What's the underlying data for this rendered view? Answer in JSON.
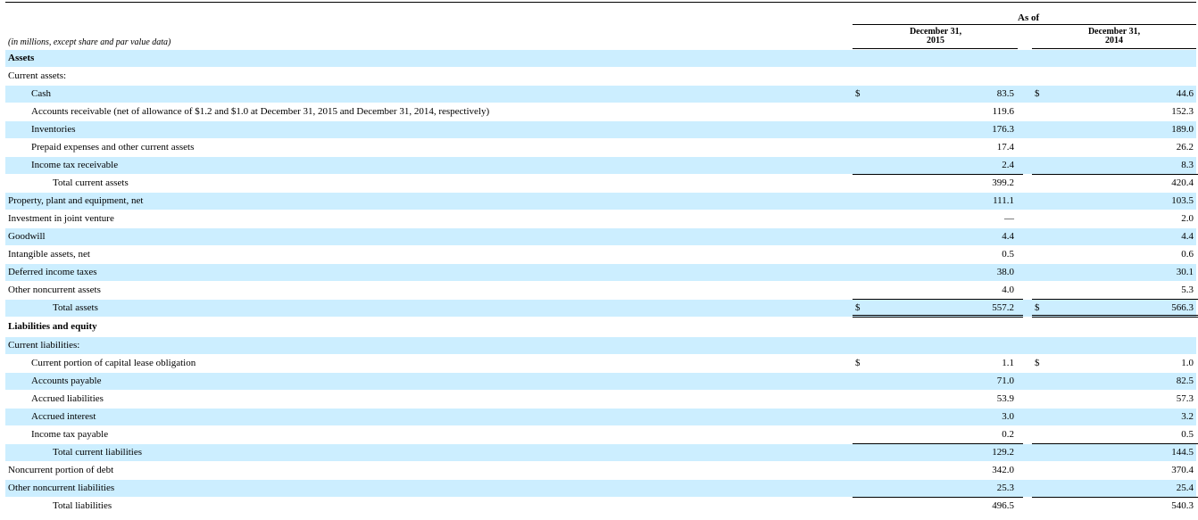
{
  "header": {
    "as_of": "As of",
    "col1_line1": "December 31,",
    "col1_line2": "2015",
    "col2_line1": "December 31,",
    "col2_line2": "2014",
    "units": "(in millions, except share and par value data)"
  },
  "rows": [
    {
      "label": "Assets",
      "c1": "",
      "v1": "",
      "c2": "",
      "v2": ""
    },
    {
      "label": "Current assets:",
      "c1": "",
      "v1": "",
      "c2": "",
      "v2": ""
    },
    {
      "label": "Cash",
      "c1": "$",
      "v1": "83.5",
      "c2": "$",
      "v2": "44.6"
    },
    {
      "label": "Accounts receivable (net of allowance of $1.2 and $1.0 at December 31, 2015 and December 31, 2014, respectively)",
      "c1": "",
      "v1": "119.6",
      "c2": "",
      "v2": "152.3"
    },
    {
      "label": "Inventories",
      "c1": "",
      "v1": "176.3",
      "c2": "",
      "v2": "189.0"
    },
    {
      "label": "Prepaid expenses and other current assets",
      "c1": "",
      "v1": "17.4",
      "c2": "",
      "v2": "26.2"
    },
    {
      "label": "Income tax receivable",
      "c1": "",
      "v1": "2.4",
      "c2": "",
      "v2": "8.3"
    },
    {
      "label": "Total current assets",
      "c1": "",
      "v1": "399.2",
      "c2": "",
      "v2": "420.4"
    },
    {
      "label": "Property, plant and equipment, net",
      "c1": "",
      "v1": "111.1",
      "c2": "",
      "v2": "103.5"
    },
    {
      "label": "Investment in joint venture",
      "c1": "",
      "v1": "—",
      "c2": "",
      "v2": "2.0"
    },
    {
      "label": "Goodwill",
      "c1": "",
      "v1": "4.4",
      "c2": "",
      "v2": "4.4"
    },
    {
      "label": "Intangible assets, net",
      "c1": "",
      "v1": "0.5",
      "c2": "",
      "v2": "0.6"
    },
    {
      "label": "Deferred income taxes",
      "c1": "",
      "v1": "38.0",
      "c2": "",
      "v2": "30.1"
    },
    {
      "label": "Other noncurrent assets",
      "c1": "",
      "v1": "4.0",
      "c2": "",
      "v2": "5.3"
    },
    {
      "label": "Total assets",
      "c1": "$",
      "v1": "557.2",
      "c2": "$",
      "v2": "566.3"
    },
    {
      "label": "Liabilities and equity",
      "c1": "",
      "v1": "",
      "c2": "",
      "v2": ""
    },
    {
      "label": "Current liabilities:",
      "c1": "",
      "v1": "",
      "c2": "",
      "v2": ""
    },
    {
      "label": "Current portion of capital lease obligation",
      "c1": "$",
      "v1": "1.1",
      "c2": "$",
      "v2": "1.0"
    },
    {
      "label": "Accounts payable",
      "c1": "",
      "v1": "71.0",
      "c2": "",
      "v2": "82.5"
    },
    {
      "label": "Accrued liabilities",
      "c1": "",
      "v1": "53.9",
      "c2": "",
      "v2": "57.3"
    },
    {
      "label": "Accrued interest",
      "c1": "",
      "v1": "3.0",
      "c2": "",
      "v2": "3.2"
    },
    {
      "label": "Income tax payable",
      "c1": "",
      "v1": "0.2",
      "c2": "",
      "v2": "0.5"
    },
    {
      "label": "Total current liabilities",
      "c1": "",
      "v1": "129.2",
      "c2": "",
      "v2": "144.5"
    },
    {
      "label": "Noncurrent portion of debt",
      "c1": "",
      "v1": "342.0",
      "c2": "",
      "v2": "370.4"
    },
    {
      "label": "Other noncurrent liabilities",
      "c1": "",
      "v1": "25.3",
      "c2": "",
      "v2": "25.4"
    },
    {
      "label": "Total liabilities",
      "c1": "",
      "v1": "496.5",
      "c2": "",
      "v2": "540.3"
    }
  ]
}
